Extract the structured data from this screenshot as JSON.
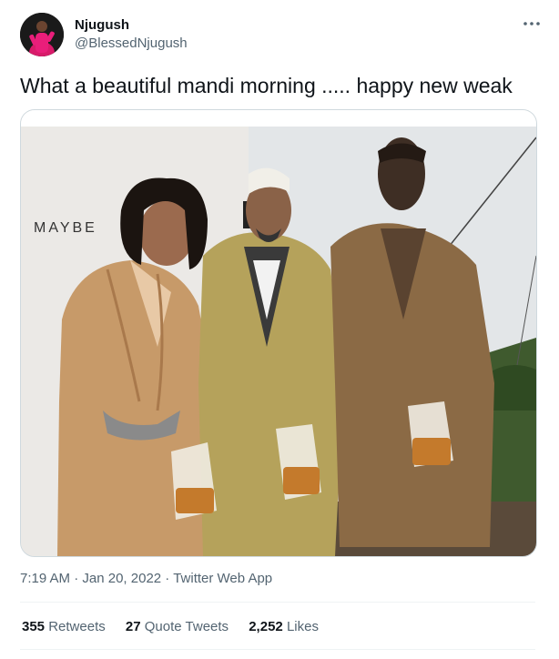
{
  "user": {
    "display_name": "Njugush",
    "handle": "@BlessedNjugush"
  },
  "more_icon": "more-horizontal-icon",
  "tweet": {
    "text": "What a beautiful mandi morning ..... happy new weak"
  },
  "media": {
    "banner_text": "MAYBE"
  },
  "meta": {
    "time": "7:19 AM",
    "sep1": " · ",
    "date": "Jan 20, 2022",
    "sep2": " · ",
    "source": "Twitter Web App"
  },
  "stats": {
    "retweets_count": "355",
    "retweets_label": "Retweets",
    "quotes_count": "27",
    "quotes_label": "Quote Tweets",
    "likes_count": "2,252",
    "likes_label": "Likes"
  },
  "colors": {
    "text": "#0f1419",
    "secondary": "#536471",
    "border": "#cfd9de",
    "divider": "#eff3f4"
  }
}
